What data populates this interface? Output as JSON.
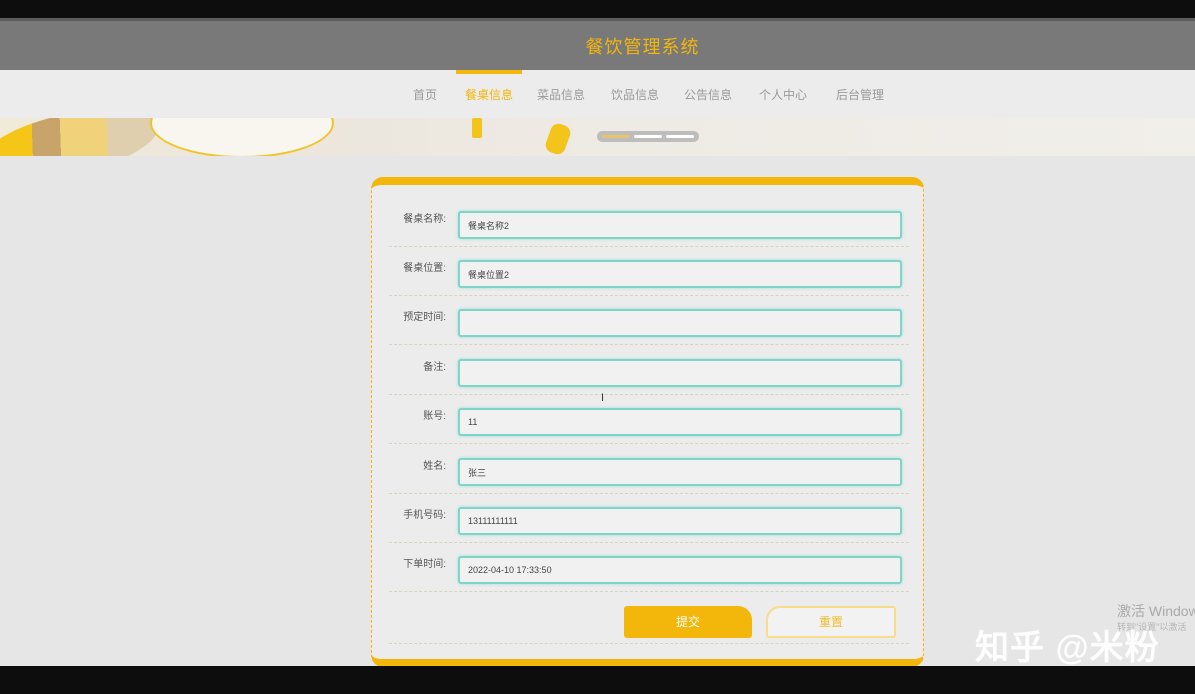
{
  "app": {
    "title": "餐饮管理系统"
  },
  "nav": {
    "items": [
      {
        "label": "首页"
      },
      {
        "label": "餐桌信息"
      },
      {
        "label": "菜品信息"
      },
      {
        "label": "饮品信息"
      },
      {
        "label": "公告信息"
      },
      {
        "label": "个人中心"
      },
      {
        "label": "后台管理"
      }
    ],
    "active_index": 1
  },
  "carousel": {
    "slide_count": 3,
    "active_slide": 1
  },
  "form": {
    "fields": [
      {
        "label": "餐桌名称:",
        "value": "餐桌名称2"
      },
      {
        "label": "餐桌位置:",
        "value": "餐桌位置2"
      },
      {
        "label": "预定时间:",
        "value": ""
      },
      {
        "label": "备注:",
        "value": ""
      },
      {
        "label": "账号:",
        "value": "11"
      },
      {
        "label": "姓名:",
        "value": "张三"
      },
      {
        "label": "手机号码:",
        "value": "13111111111"
      },
      {
        "label": "下单时间:",
        "value": "2022-04-10 17:33:50"
      }
    ],
    "submit_label": "提交",
    "reset_label": "重置"
  },
  "overlay": {
    "watermark": "知乎 @米粉",
    "activate_windows": "激活 Windows",
    "activate_windows_hint": "转到\"设置\"以激活"
  },
  "colors": {
    "accent": "#f3b60a",
    "header_bg": "#797979",
    "field_border": "#7fd4c8"
  }
}
